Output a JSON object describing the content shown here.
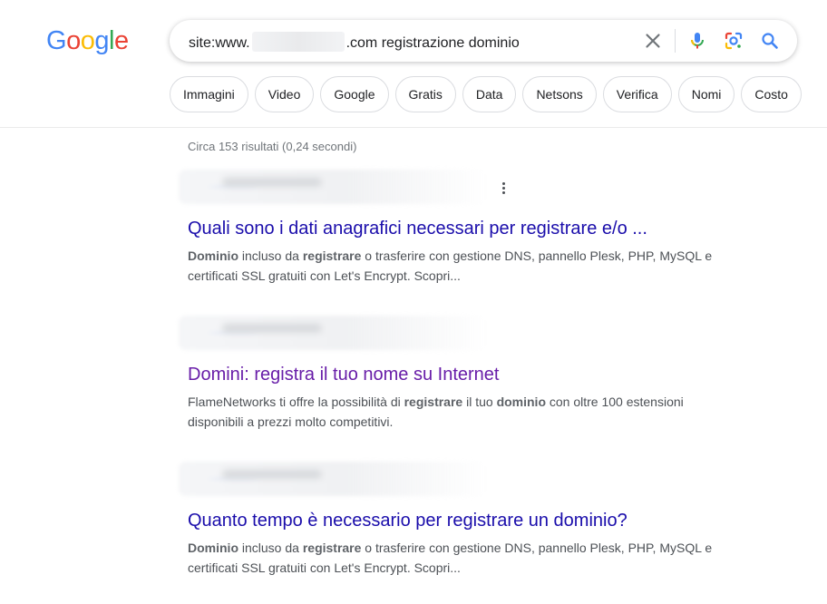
{
  "logo": {
    "letters": [
      "G",
      "o",
      "o",
      "g",
      "l",
      "e"
    ],
    "colors": [
      "#4285F4",
      "#EA4335",
      "#FBBC05",
      "#4285F4",
      "#34A853",
      "#EA4335"
    ]
  },
  "search": {
    "query_prefix": "site:www.",
    "query_suffix": ".com registrazione dominio",
    "icons": {
      "clear": "close-icon",
      "voice": "microphone-icon",
      "lens": "google-lens-icon",
      "search": "search-icon"
    }
  },
  "chips": [
    "Immagini",
    "Video",
    "Google",
    "Gratis",
    "Data",
    "Netsons",
    "Verifica",
    "Nomi",
    "Costo"
  ],
  "stats": "Circa 153 risultati (0,24 secondi)",
  "results": [
    {
      "title": "Quali sono i dati anagrafici necessari per registrare e/o ...",
      "visited": false,
      "snippet_parts": [
        {
          "t": "Dominio",
          "b": true
        },
        {
          "t": " incluso da ",
          "b": false
        },
        {
          "t": "registrare",
          "b": true
        },
        {
          "t": " o trasferire con gestione DNS, pannello Plesk, PHP, MySQL e certificati SSL gratuiti con Let's Encrypt. Scopri...",
          "b": false
        }
      ]
    },
    {
      "title": "Domini: registra il tuo nome su Internet",
      "visited": true,
      "snippet_parts": [
        {
          "t": "FlameNetworks ti offre la possibilità di ",
          "b": false
        },
        {
          "t": "registrare",
          "b": true
        },
        {
          "t": " il tuo ",
          "b": false
        },
        {
          "t": "dominio",
          "b": true
        },
        {
          "t": " con oltre 100 estensioni disponibili a prezzi molto competitivi.",
          "b": false
        }
      ]
    },
    {
      "title": "Quanto tempo è necessario per registrare un dominio?",
      "visited": false,
      "snippet_parts": [
        {
          "t": "Dominio",
          "b": true
        },
        {
          "t": " incluso da ",
          "b": false
        },
        {
          "t": "registrare",
          "b": true
        },
        {
          "t": " o trasferire con gestione DNS, pannello Plesk, PHP, MySQL e certificati SSL gratuiti con Let's Encrypt. Scopri...",
          "b": false
        }
      ]
    }
  ]
}
